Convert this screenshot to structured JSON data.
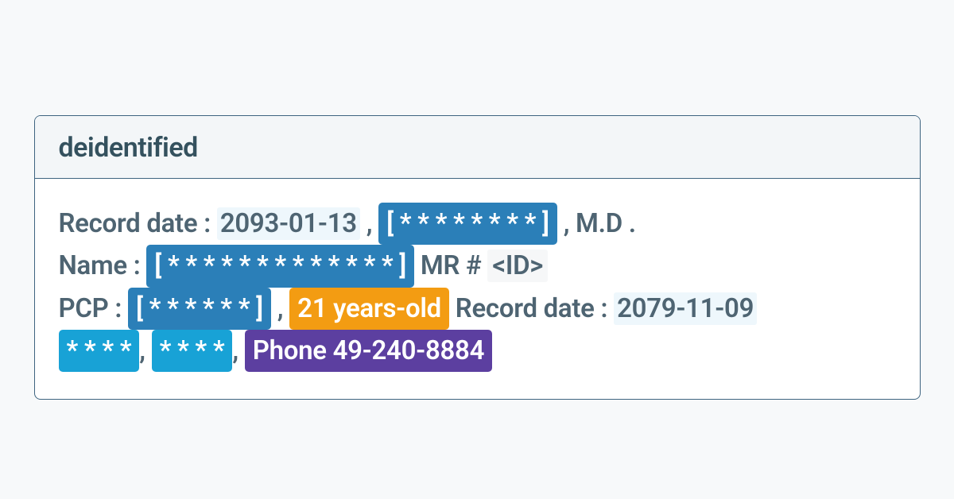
{
  "panel": {
    "title": "deidentified",
    "body": {
      "line1": {
        "label": "Record date :",
        "date": "2093-01-13",
        "sep1": ",",
        "masked_name": "[ * * * * * * * * ]",
        "sep2": ",",
        "suffix": "M.D ."
      },
      "line2": {
        "label": "Name :",
        "masked_name": "[ * * * * * * * * * * * * * ]",
        "mr_label": "MR #",
        "id": "<ID>"
      },
      "line3": {
        "label": "PCP :",
        "masked_pcp": "[ * * * * * * ]",
        "sep": ",",
        "age": "21 years-old",
        "rec_label": "Record date :",
        "date": "2079-11-09"
      },
      "line4": {
        "masked1": "* * * *",
        "sep1": ",",
        "masked2": "* * * *",
        "sep2": ",",
        "phone": "Phone 49-240-8884"
      }
    }
  }
}
